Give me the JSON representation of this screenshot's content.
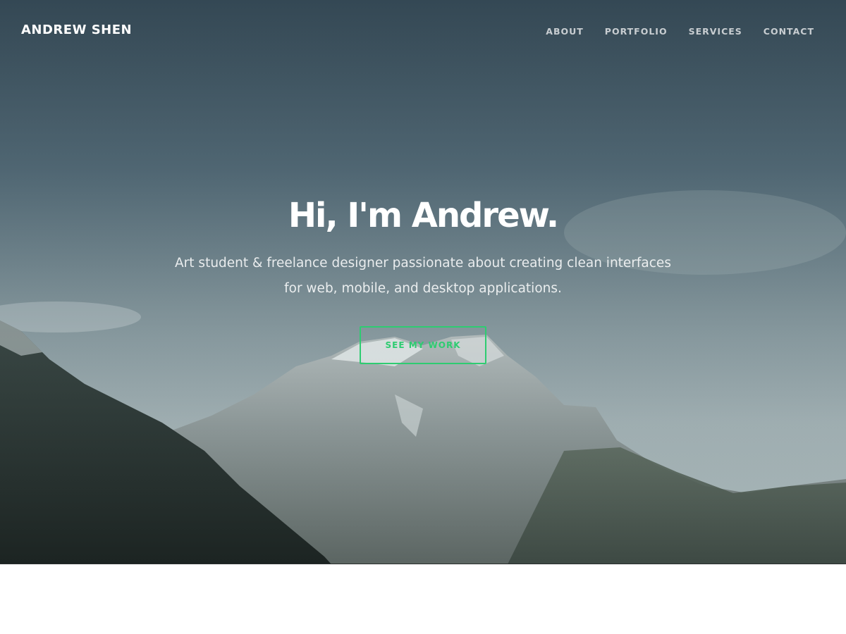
{
  "header": {
    "brand": "ANDREW SHEN",
    "nav": [
      {
        "label": "ABOUT"
      },
      {
        "label": "PORTFOLIO"
      },
      {
        "label": "SERVICES"
      },
      {
        "label": "CONTACT"
      }
    ]
  },
  "hero": {
    "title": "Hi, I'm Andrew.",
    "subtitle": "Art student & freelance designer passionate about creating clean interfaces for web, mobile, and desktop applications.",
    "cta_label": "SEE MY WORK",
    "background_image": "mountain-landscape-photo"
  },
  "colors": {
    "accent": "#2ecc71",
    "text_light": "#ffffff"
  }
}
